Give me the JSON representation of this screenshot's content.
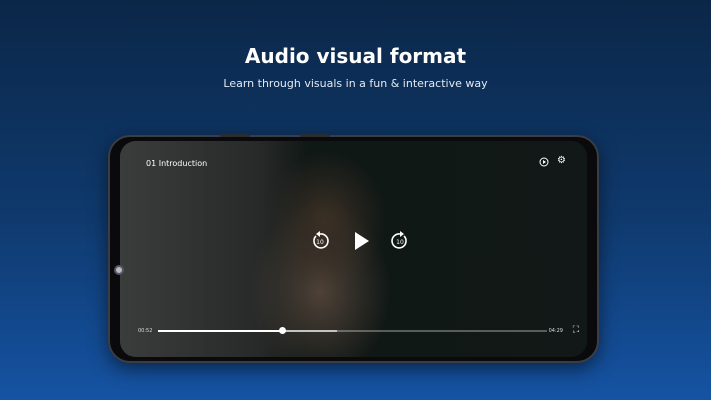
{
  "header": {
    "title": "Audio visual format",
    "subtitle": "Learn through visuals in a fun & interactive way"
  },
  "player": {
    "episode_title": "01 Introduction",
    "current_time": "00:52",
    "duration": "04:29",
    "progress_percent": 32,
    "buffered_percent": 46,
    "rewind_seconds": "10",
    "forward_seconds": "10",
    "icons": [
      "playback-speed-icon",
      "settings-gear-icon",
      "rewind-10-icon",
      "play-icon",
      "forward-10-icon",
      "fullscreen-exit-icon"
    ]
  }
}
